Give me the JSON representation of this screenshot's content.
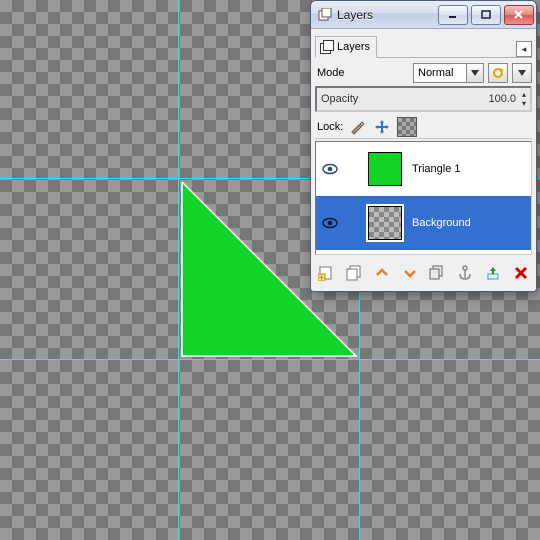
{
  "window": {
    "title": "Layers"
  },
  "tabs": {
    "layers_label": "Layers"
  },
  "mode": {
    "label": "Mode",
    "value": "Normal"
  },
  "opacity": {
    "label": "Opacity",
    "value": "100.0"
  },
  "lock": {
    "label": "Lock:"
  },
  "layers": [
    {
      "name": "Triangle 1"
    },
    {
      "name": "Background"
    }
  ],
  "icons": {
    "minimize": "minimize-icon",
    "maximize": "maximize-icon",
    "close": "close-icon"
  },
  "guides": {
    "v1": 178,
    "v2": 359,
    "h1": 178,
    "h2": 359
  },
  "triangle_color": "#12d426"
}
